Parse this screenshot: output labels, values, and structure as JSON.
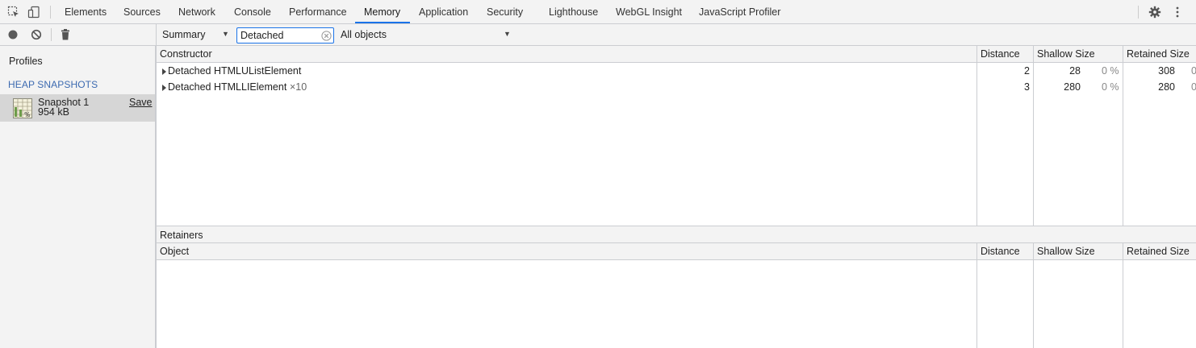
{
  "tabs": [
    "Elements",
    "Sources",
    "Network",
    "Console",
    "Performance",
    "Memory",
    "Application",
    "Security",
    "Lighthouse",
    "WebGL Insight",
    "JavaScript Profiler"
  ],
  "active_tab": "Memory",
  "sidebar": {
    "profiles_label": "Profiles",
    "section_label": "HEAP SNAPSHOTS",
    "snapshot": {
      "title": "Snapshot 1",
      "size": "954 kB",
      "save_label": "Save"
    }
  },
  "toolbar": {
    "view": "Summary",
    "filter_value": "Detached",
    "objects": "All objects"
  },
  "constructor_table": {
    "headers": {
      "name": "Constructor",
      "distance": "Distance",
      "shallow": "Shallow Size",
      "retained": "Retained Size"
    },
    "rows": [
      {
        "name": "Detached HTMLUListElement",
        "count": "",
        "distance": "2",
        "shallow": "28",
        "shallow_pct": "0 %",
        "retained": "308",
        "retained_pct": "0"
      },
      {
        "name": "Detached HTMLLIElement",
        "count": "×10",
        "distance": "3",
        "shallow": "280",
        "shallow_pct": "0 %",
        "retained": "280",
        "retained_pct": "0"
      }
    ]
  },
  "retainers": {
    "label": "Retainers",
    "headers": {
      "name": "Object",
      "distance": "Distance",
      "shallow": "Shallow Size",
      "retained": "Retained Size"
    }
  },
  "colors": {
    "accent": "#1a73e8",
    "toolbar_bg": "#f3f3f3",
    "border": "#cbcdd1",
    "selected_row": "#d6d6d6",
    "section_label": "#3c6ab0"
  }
}
